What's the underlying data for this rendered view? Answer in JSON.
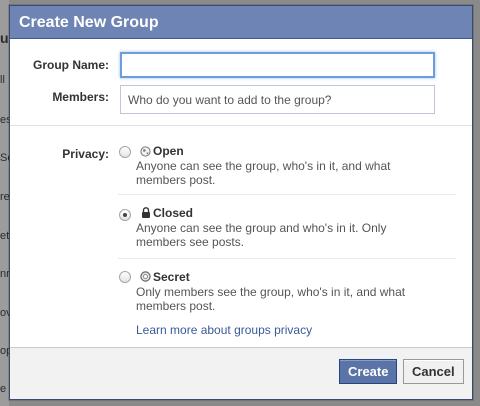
{
  "dialog": {
    "title": "Create New Group"
  },
  "form": {
    "group_name_label": "Group Name:",
    "group_name_value": "",
    "members_label": "Members:",
    "members_placeholder": "Who do you want to add to the group?",
    "privacy_label": "Privacy:"
  },
  "privacy_options": [
    {
      "title": "Open",
      "icon": "globe-icon",
      "description": "Anyone can see the group, who's in it, and what members post.",
      "selected": false
    },
    {
      "title": "Closed",
      "icon": "lock-icon",
      "description": "Anyone can see the group and who's in it. Only members see posts.",
      "selected": true
    },
    {
      "title": "Secret",
      "icon": "secret-circle-icon",
      "description": "Only members see the group, who's in it, and what members post.",
      "selected": false
    }
  ],
  "learn_more_link": "Learn more about groups privacy",
  "footer": {
    "create_label": "Create",
    "cancel_label": "Cancel"
  },
  "background": {
    "fragments": [
      "up",
      "ll",
      "es",
      "Se",
      "rea",
      "ett",
      "nr",
      "ov",
      "op",
      "e B"
    ]
  },
  "colors": {
    "header": "#6d84b4",
    "link": "#3b5998",
    "primary_button": "#5b74a8"
  }
}
